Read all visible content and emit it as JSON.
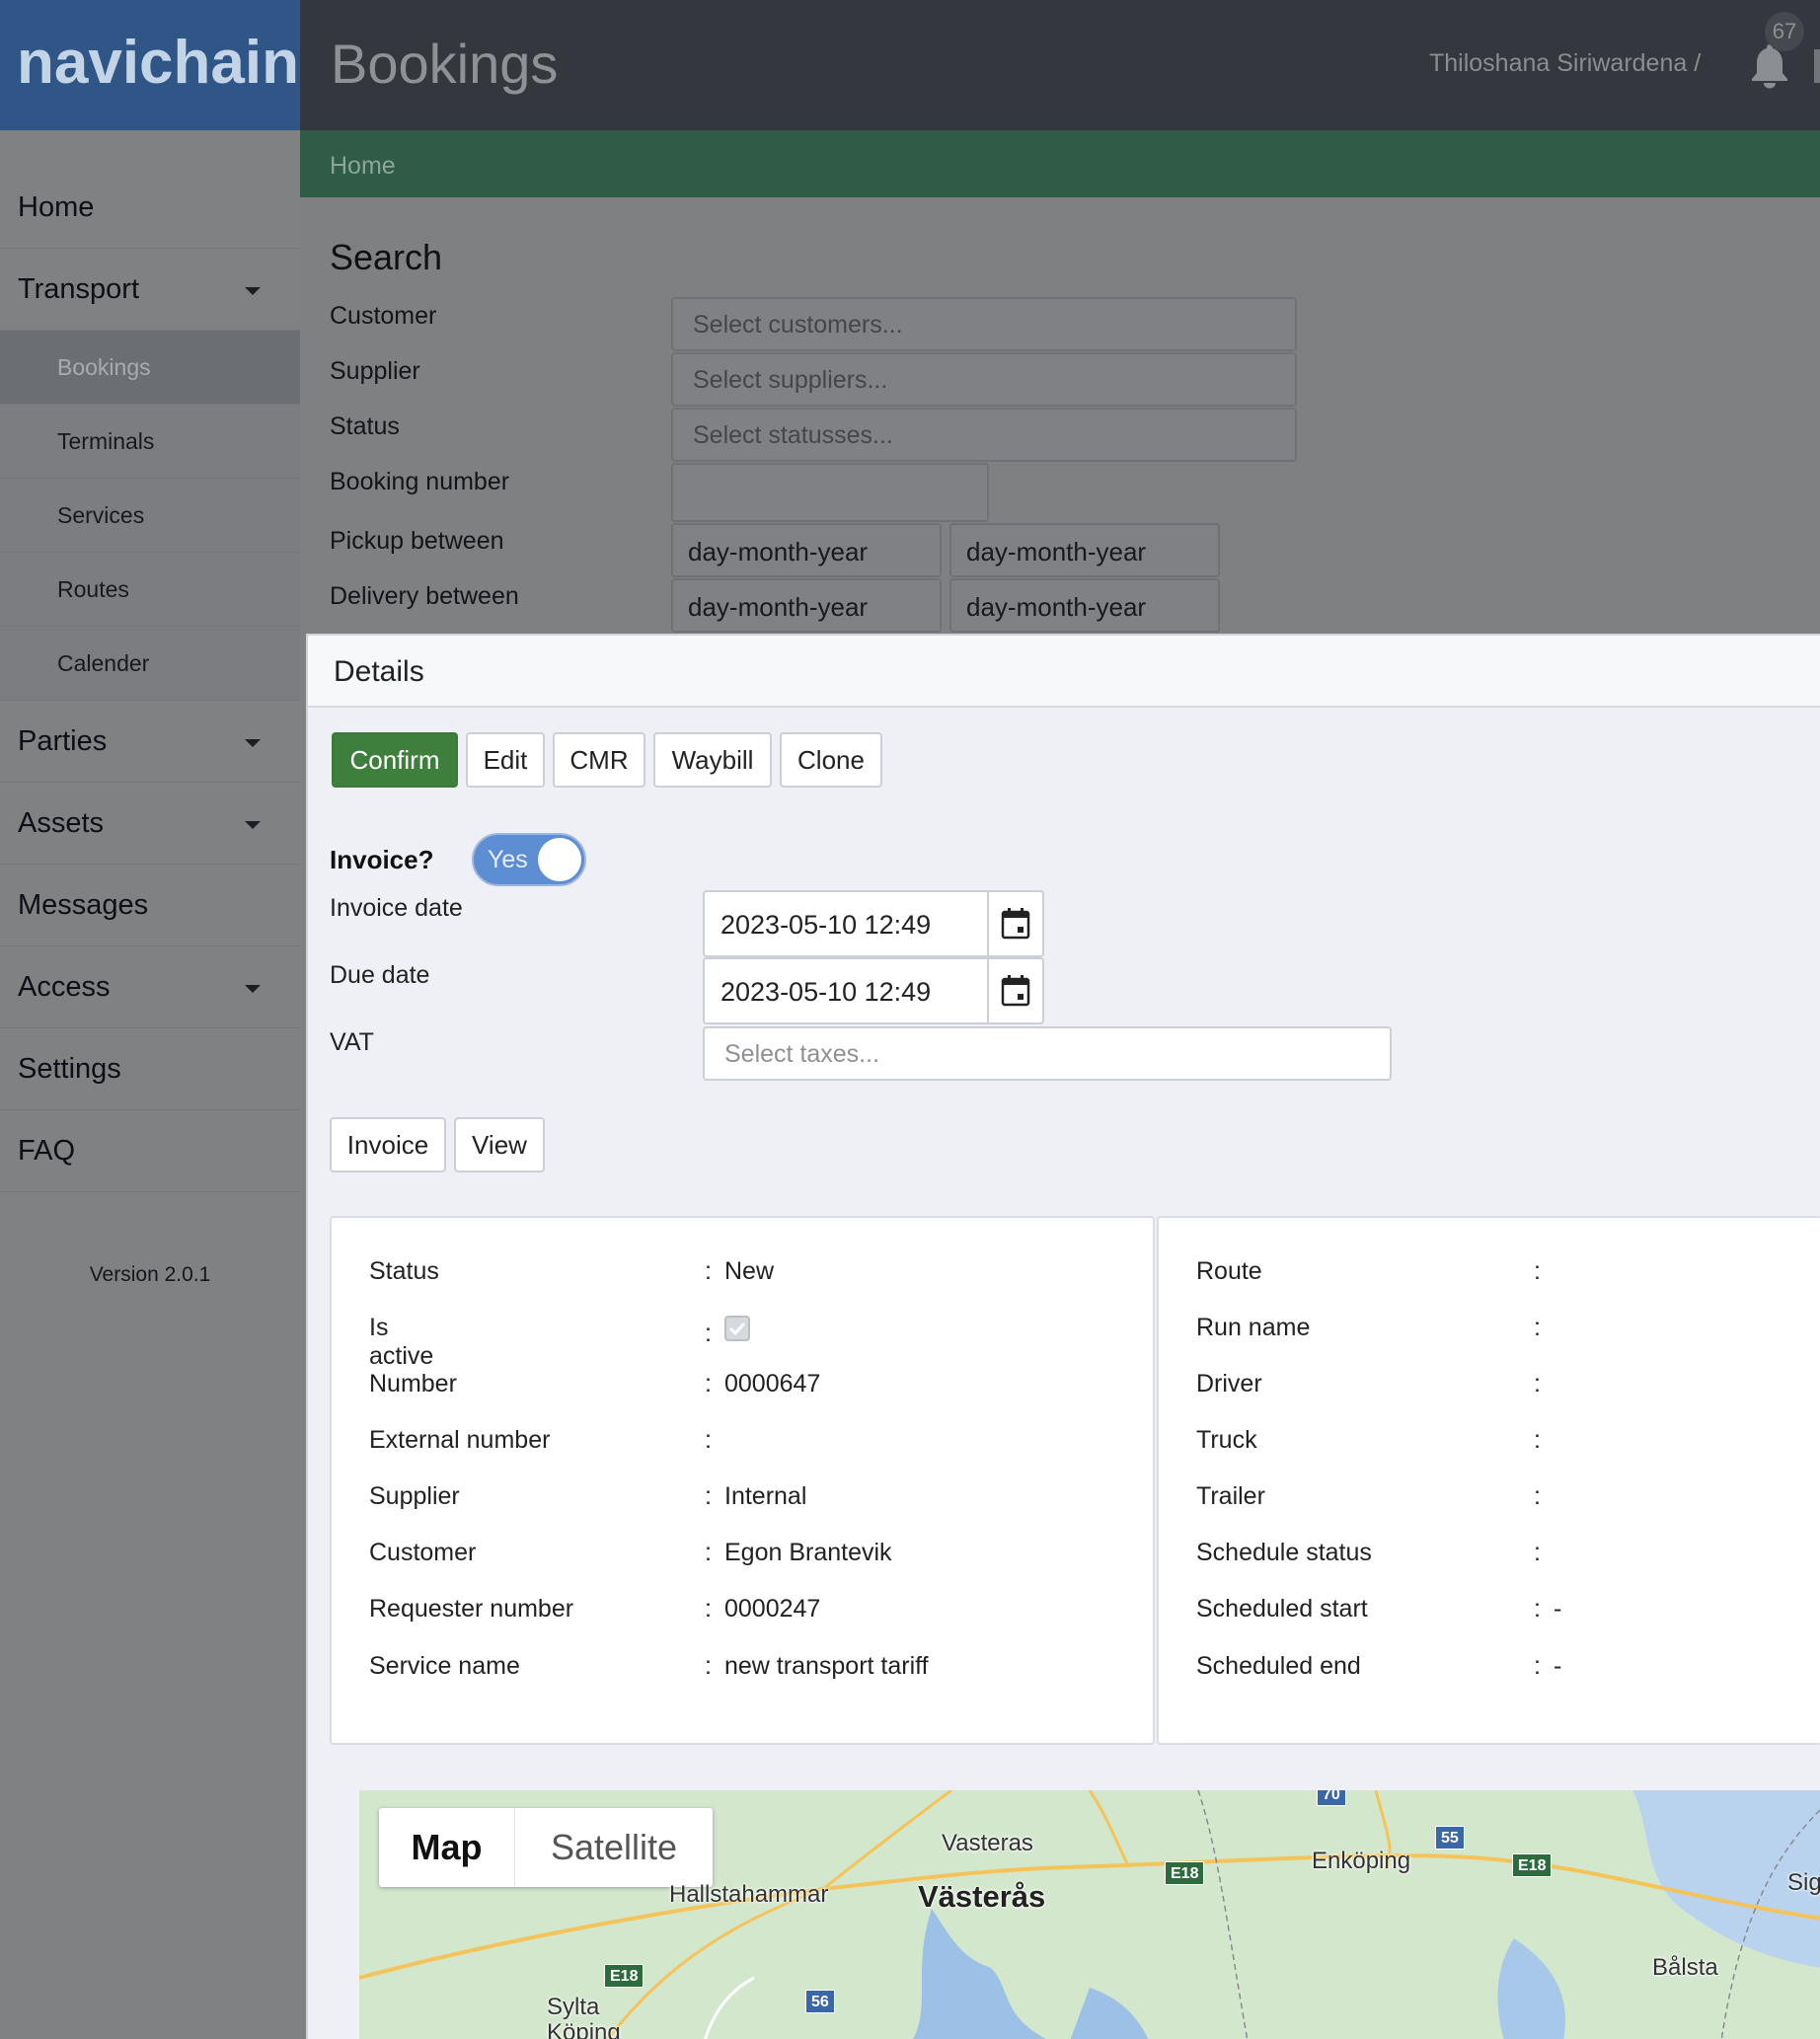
{
  "app": {
    "logo": "navichain",
    "title": "Bookings",
    "user": "Thiloshana Siriwardena /",
    "notifications": "67"
  },
  "sidebar": {
    "items": [
      {
        "label": "Home"
      },
      {
        "label": "Transport"
      },
      {
        "label": "Bookings"
      },
      {
        "label": "Terminals"
      },
      {
        "label": "Services"
      },
      {
        "label": "Routes"
      },
      {
        "label": "Calender"
      },
      {
        "label": "Parties"
      },
      {
        "label": "Assets"
      },
      {
        "label": "Messages"
      },
      {
        "label": "Access"
      },
      {
        "label": "Settings"
      },
      {
        "label": "FAQ"
      }
    ],
    "version": "Version 2.0.1"
  },
  "breadcrumb": {
    "home": "Home"
  },
  "search": {
    "title": "Search",
    "customer_label": "Customer",
    "customer_placeholder": "Select customers...",
    "supplier_label": "Supplier",
    "supplier_placeholder": "Select suppliers...",
    "status_label": "Status",
    "status_placeholder": "Select statusses...",
    "booking_number_label": "Booking number",
    "booking_number_value": "",
    "pickup_label": "Pickup between",
    "pickup_from": "day-month-year",
    "pickup_to": "day-month-year",
    "delivery_label": "Delivery between",
    "delivery_from": "day-month-year",
    "delivery_to": "day-month-year"
  },
  "details": {
    "title": "Details",
    "actions": {
      "confirm": "Confirm",
      "edit": "Edit",
      "cmr": "CMR",
      "waybill": "Waybill",
      "clone": "Clone"
    },
    "invoice_label": "Invoice?",
    "invoice_toggle": "Yes",
    "invoice_date_label": "Invoice date",
    "invoice_date": "2023-05-10 12:49",
    "due_date_label": "Due date",
    "due_date": "2023-05-10 12:49",
    "vat_label": "VAT",
    "vat_placeholder": "Select taxes...",
    "invoice_button": "Invoice",
    "view_button": "View",
    "left_card": {
      "status_label": "Status",
      "status": "New",
      "active_label": "Is active",
      "number_label": "Number",
      "number": "0000647",
      "external_label": "External number",
      "external": "",
      "supplier_label": "Supplier",
      "supplier": "Internal",
      "customer_label": "Customer",
      "customer": "Egon Brantevik",
      "requester_label": "Requester number",
      "requester": "0000247",
      "service_label": "Service name",
      "service": "new transport tariff"
    },
    "right_card": {
      "route_label": "Route",
      "route": "",
      "run_label": "Run name",
      "run": "",
      "driver_label": "Driver",
      "driver": "",
      "truck_label": "Truck",
      "truck": "",
      "trailer_label": "Trailer",
      "trailer": "",
      "schedule_status_label": "Schedule status",
      "schedule_status": "",
      "scheduled_start_label": "Scheduled start",
      "scheduled_start": "-",
      "scheduled_end_label": "Scheduled end",
      "scheduled_end": "-"
    },
    "colon": ":"
  },
  "map": {
    "map_button": "Map",
    "satellite_button": "Satellite",
    "places": [
      "Vasteras",
      "Hallstahammar",
      "Västerås",
      "Enköping",
      "Sigt",
      "Bålsta",
      "Sylta",
      "Köping"
    ],
    "roads": [
      "70",
      "55",
      "E18",
      "E18",
      "E18",
      "56"
    ]
  }
}
